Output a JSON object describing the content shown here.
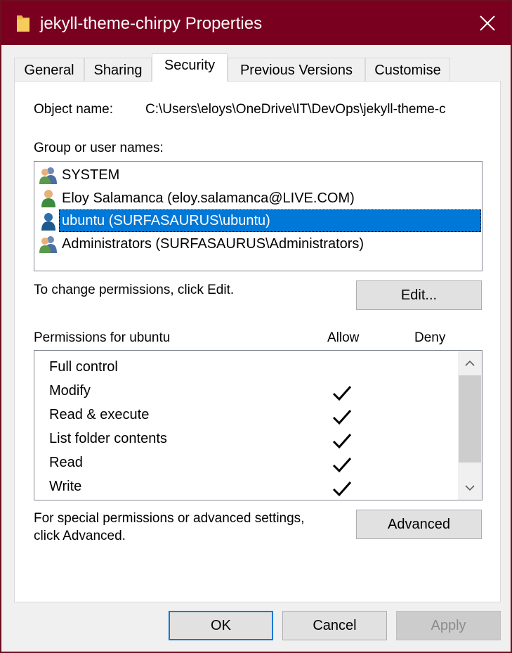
{
  "window": {
    "title": "jekyll-theme-chirpy Properties",
    "title_bar_color": "#7a0020",
    "folder_icon": "folder-icon",
    "close_icon": "close-icon"
  },
  "tabs": [
    {
      "label": "General"
    },
    {
      "label": "Sharing"
    },
    {
      "label": "Security"
    },
    {
      "label": "Previous Versions"
    },
    {
      "label": "Customise"
    }
  ],
  "security": {
    "object_name_label": "Object name:",
    "object_name_value": "C:\\Users\\eloys\\OneDrive\\IT\\DevOps\\jekyll-theme-c",
    "groups_label": "Group or user names:",
    "users": [
      {
        "name": "SYSTEM",
        "icon": "group-users-icon"
      },
      {
        "name": "Eloy Salamanca (eloy.salamanca@LIVE.COM)",
        "icon": "user-icon"
      },
      {
        "name": "ubuntu (SURFASAURUS\\ubuntu)",
        "icon": "user-icon"
      },
      {
        "name": "Administrators (SURFASAURUS\\Administrators)",
        "icon": "group-users-icon"
      }
    ],
    "selected_color": "#0078d7",
    "change_hint": "To change permissions, click Edit.",
    "edit_button": "Edit...",
    "permissions_label": "Permissions for ubuntu",
    "allow_header": "Allow",
    "deny_header": "Deny",
    "permissions": [
      {
        "name": "Full control",
        "allow": false,
        "deny": false
      },
      {
        "name": "Modify",
        "allow": true,
        "deny": false
      },
      {
        "name": "Read & execute",
        "allow": true,
        "deny": false
      },
      {
        "name": "List folder contents",
        "allow": true,
        "deny": false
      },
      {
        "name": "Read",
        "allow": true,
        "deny": false
      },
      {
        "name": "Write",
        "allow": true,
        "deny": false
      }
    ],
    "advanced_hint_line1": "For special permissions or advanced settings,",
    "advanced_hint_line2": "click Advanced.",
    "advanced_button": "Advanced"
  },
  "footer": {
    "ok": "OK",
    "cancel": "Cancel",
    "apply": "Apply"
  }
}
